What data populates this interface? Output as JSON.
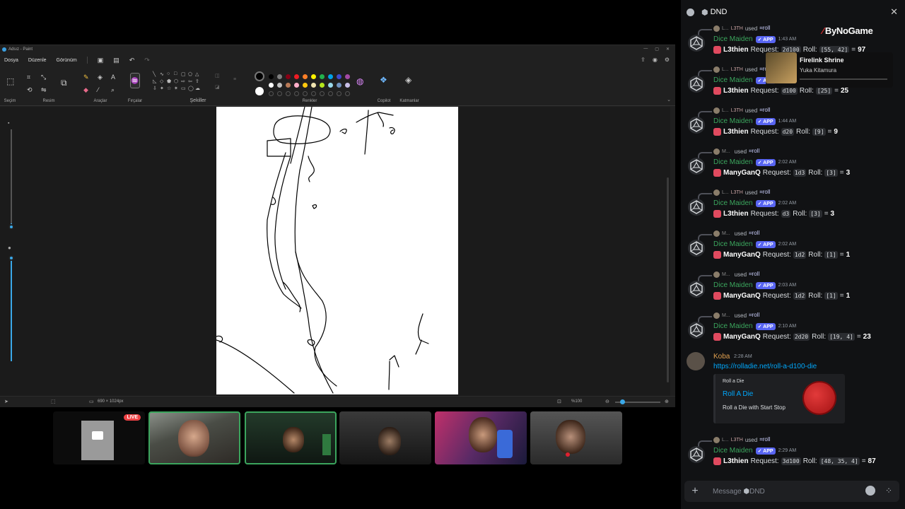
{
  "paint": {
    "title": "Adsız - Paint",
    "menu": [
      "Dosya",
      "Düzenle",
      "Görünüm"
    ],
    "groups": {
      "selection": "Seçim",
      "image": "Resim",
      "tools": "Araçlar",
      "brushes": "Fırçalar",
      "shapes": "Şekiller",
      "colors": "Renkler",
      "copilot": "Copilot",
      "layers": "Katmanlar"
    },
    "palette": [
      "#000000",
      "#7f7f7f",
      "#880015",
      "#ed1c24",
      "#ff7f27",
      "#fff200",
      "#22b14c",
      "#00a2e8",
      "#3f48cc",
      "#a349a4",
      "#ffffff",
      "#c3c3c3",
      "#b97a57",
      "#ffaec9",
      "#ffc90e",
      "#efe4b0",
      "#b5e61d",
      "#99d9ea",
      "#7092be",
      "#c8bfe7"
    ],
    "status": {
      "dimensions": "690 × 1024px",
      "zoom": "%100",
      "zoom_fraction": 0.1
    }
  },
  "webcams": {
    "live_label": "LIVE",
    "tiles": [
      "screen-share",
      "streamer-1",
      "streamer-2",
      "streamer-3",
      "streamer-4",
      "streamer-5"
    ]
  },
  "discord": {
    "channel": "DND",
    "messages": [
      {
        "reply_name": "L...",
        "reply_tag": "L3TH",
        "reply_used": "used",
        "reply_cmd": "roll",
        "bot": "Dice Maiden",
        "app": "APP",
        "time": "1:43 AM",
        "user": "L3thien",
        "request_label": "Request:",
        "request": "2d100",
        "roll_label": "Roll:",
        "roll": "[55, 42]",
        "eq": "=",
        "total": "97"
      },
      {
        "reply_name": "L...",
        "reply_tag": "L3TH",
        "reply_used": "used",
        "reply_cmd": "roll",
        "bot": "Dice Maiden",
        "app": "APP",
        "time": "1:43 AM",
        "user": "L3thien",
        "request_label": "Request:",
        "request": "d100",
        "roll_label": "Roll:",
        "roll": "[25]",
        "eq": "=",
        "total": "25"
      },
      {
        "reply_name": "L...",
        "reply_tag": "L3TH",
        "reply_used": "used",
        "reply_cmd": "roll",
        "bot": "Dice Maiden",
        "app": "APP",
        "time": "1:44 AM",
        "user": "L3thien",
        "request_label": "Request:",
        "request": "d20",
        "roll_label": "Roll:",
        "roll": "[9]",
        "eq": "=",
        "total": "9"
      },
      {
        "reply_name": "M...",
        "reply_tag": "",
        "reply_used": "used",
        "reply_cmd": "roll",
        "bot": "Dice Maiden",
        "app": "APP",
        "time": "2:02 AM",
        "user": "ManyGanQ",
        "request_label": "Request:",
        "request": "1d3",
        "roll_label": "Roll:",
        "roll": "[3]",
        "eq": "=",
        "total": "3"
      },
      {
        "reply_name": "L...",
        "reply_tag": "L3TH",
        "reply_used": "used",
        "reply_cmd": "roll",
        "bot": "Dice Maiden",
        "app": "APP",
        "time": "2:02 AM",
        "user": "L3thien",
        "request_label": "Request:",
        "request": "d3",
        "roll_label": "Roll:",
        "roll": "[3]",
        "eq": "=",
        "total": "3"
      },
      {
        "reply_name": "M...",
        "reply_tag": "",
        "reply_used": "used",
        "reply_cmd": "roll",
        "bot": "Dice Maiden",
        "app": "APP",
        "time": "2:02 AM",
        "user": "ManyGanQ",
        "request_label": "Request:",
        "request": "1d2",
        "roll_label": "Roll:",
        "roll": "[1]",
        "eq": "=",
        "total": "1"
      },
      {
        "reply_name": "M...",
        "reply_tag": "",
        "reply_used": "used",
        "reply_cmd": "roll",
        "bot": "Dice Maiden",
        "app": "APP",
        "time": "2:03 AM",
        "user": "ManyGanQ",
        "request_label": "Request:",
        "request": "1d2",
        "roll_label": "Roll:",
        "roll": "[1]",
        "eq": "=",
        "total": "1"
      },
      {
        "reply_name": "M...",
        "reply_tag": "",
        "reply_used": "used",
        "reply_cmd": "roll",
        "bot": "Dice Maiden",
        "app": "APP",
        "time": "2:10 AM",
        "user": "ManyGanQ",
        "request_label": "Request:",
        "request": "2d20",
        "roll_label": "Roll:",
        "roll": "[19, 4]",
        "eq": "=",
        "total": "23"
      }
    ],
    "koba": {
      "name": "Koba",
      "time": "2:28 AM",
      "link": "https://rolladie.net/roll-a-d100-die",
      "embed_site": "Roll a Die",
      "embed_title": "Roll A Die",
      "embed_desc": "Roll a Die with Start Stop"
    },
    "last": {
      "reply_name": "L...",
      "reply_tag": "L3TH",
      "reply_used": "used",
      "reply_cmd": "roll",
      "bot": "Dice Maiden",
      "app": "APP",
      "time": "2:29 AM",
      "user": "L3thien",
      "request_label": "Request:",
      "request": "3d100",
      "roll_label": "Roll:",
      "roll": "[48, 35, 4]",
      "eq": "=",
      "total": "87"
    },
    "composer_placeholder": "Message",
    "composer_channel": "DND"
  },
  "overlay": {
    "brand": "ByNoGame",
    "song_title": "Firelink Shrine",
    "song_artist": "Yuka Kitamura"
  }
}
